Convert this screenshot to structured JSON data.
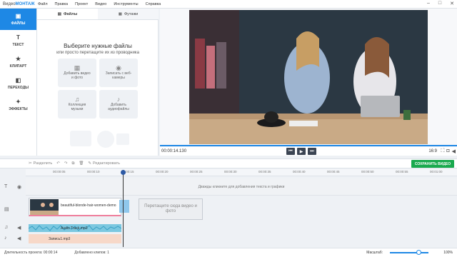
{
  "app": {
    "logo_prefix": "Видео",
    "logo_brand": "МОНТАЖ"
  },
  "menu": [
    "Файл",
    "Правка",
    "Проект",
    "Видео",
    "Инструменты",
    "Справка"
  ],
  "nav": [
    "ФАЙЛЫ",
    "ТЕКСТ",
    "КЛИПАРТ",
    "ПЕРЕХОДЫ",
    "ЭФФЕКТЫ"
  ],
  "tabs": {
    "files": "Файлы",
    "footage": "Футажи"
  },
  "panel": {
    "title": "Выберите нужные файлы",
    "subtitle": "или просто перетащите их из проводника",
    "tiles": [
      "Добавить видео и фото",
      "Записать с веб-камеры",
      "Коллекция музыки",
      "Добавить аудиофайлы"
    ]
  },
  "player": {
    "time": "00:00:14.130",
    "ratio": "16:9"
  },
  "toolbar": {
    "split": "Разделить",
    "edit": "Редактировать",
    "save": "СОХРАНИТЬ ВИДЕО"
  },
  "ruler": [
    "00:00:05",
    "00:00:10",
    "00:00:15",
    "00:00:20",
    "00:00:25",
    "00:00:30",
    "00:00:35",
    "00:00:40",
    "00:00:45",
    "00:00:50",
    "00:00:55",
    "00:01:00"
  ],
  "timeline": {
    "text_hint": "Дважды кликните для добавления текста и графики",
    "clip_name": "beautiful-blonde-hair-women-demo",
    "dropzone": "Перетащите сюда видео и фото",
    "audio1": "Audio Track.mp3",
    "audio2": "Запись1.mp3"
  },
  "status": {
    "duration": "Длительность проекта:  00:00:14",
    "clips": "Добавлено клипов: 1",
    "zoom_label": "Масштаб:",
    "zoom_value": "100%"
  }
}
